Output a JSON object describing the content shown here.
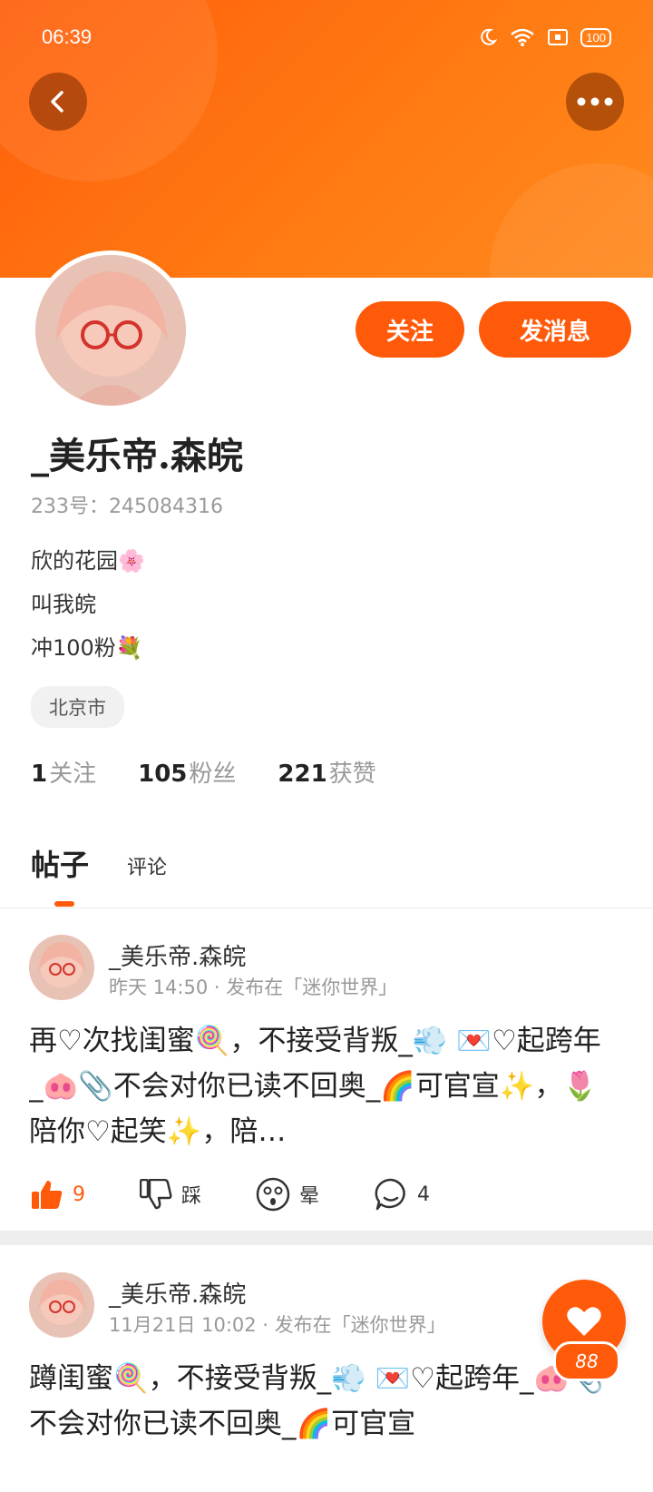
{
  "status_bar": {
    "time": "06:39",
    "battery": "100"
  },
  "profile": {
    "follow_label": "关注",
    "message_label": "发消息",
    "nickname": "_美乐帝.森皖",
    "uid_text": "233号：245084316",
    "bio": [
      "欣的花园🌸",
      "叫我皖",
      "冲100粉💐"
    ],
    "location": "北京市",
    "stats": [
      {
        "value": "1",
        "label": "关注"
      },
      {
        "value": "105",
        "label": "粉丝"
      },
      {
        "value": "221",
        "label": "获赞"
      }
    ]
  },
  "tabs": {
    "posts": "帖子",
    "comments": "评论"
  },
  "posts": [
    {
      "author": "_美乐帝.森皖",
      "meta": "昨天 14:50 · 发布在「迷你世界」",
      "content": "再♡次找闺蜜🍭，不接受背叛_💨 💌♡起跨年_🐽📎不会对你已读不回奥_🌈可官宣✨，🌷陪你♡起笑✨，陪…",
      "likes": "9",
      "dislike_label": "踩",
      "dizzy_label": "晕",
      "comments": "4"
    },
    {
      "author": "_美乐帝.森皖",
      "meta": "11月21日 10:02 · 发布在「迷你世界」",
      "content": "蹲闺蜜🍭，不接受背叛_💨 💌♡起跨年_🐽📎不会对你已读不回奥_🌈可官宣"
    }
  ],
  "floating_like": {
    "count": "88"
  }
}
